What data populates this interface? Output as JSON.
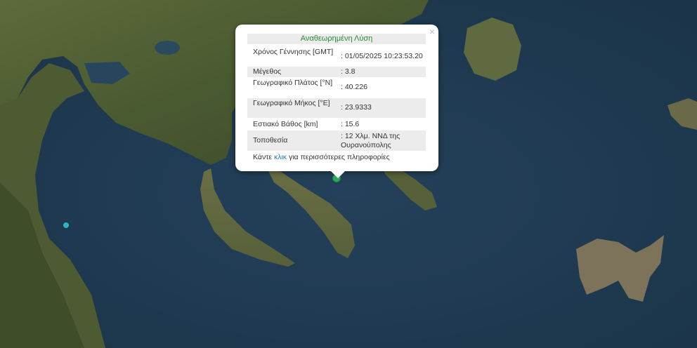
{
  "popup": {
    "title": "Αναθεωρημένη Λύση",
    "rows": [
      {
        "label": "Χρόνος Γέννησης [GMT]",
        "value": ": 01/05/2025 10:23:53.20"
      },
      {
        "label": "Μέγεθος",
        "value": ": 3.8"
      },
      {
        "label": "Γεωγραφικό Πλάτος [°N]",
        "value": ": 40.226"
      },
      {
        "label": "Γεωγραφικό Μήκος [°E]",
        "value": ": 23.9333"
      },
      {
        "label": "Εστιακό Βάθος [km]",
        "value": ": 15.6"
      },
      {
        "label": "Τοποθεσία",
        "value": ": 12 Χλμ. ΝΝΔ της Ουρανούπολης"
      }
    ],
    "more_prefix": "Κάντε ",
    "more_link": "κλικ",
    "more_suffix": " για περισσότερες πληροφορίες",
    "close": "×"
  },
  "markers": [
    {
      "color": "#2eaa5a"
    },
    {
      "color": "#2fb3c8"
    }
  ]
}
